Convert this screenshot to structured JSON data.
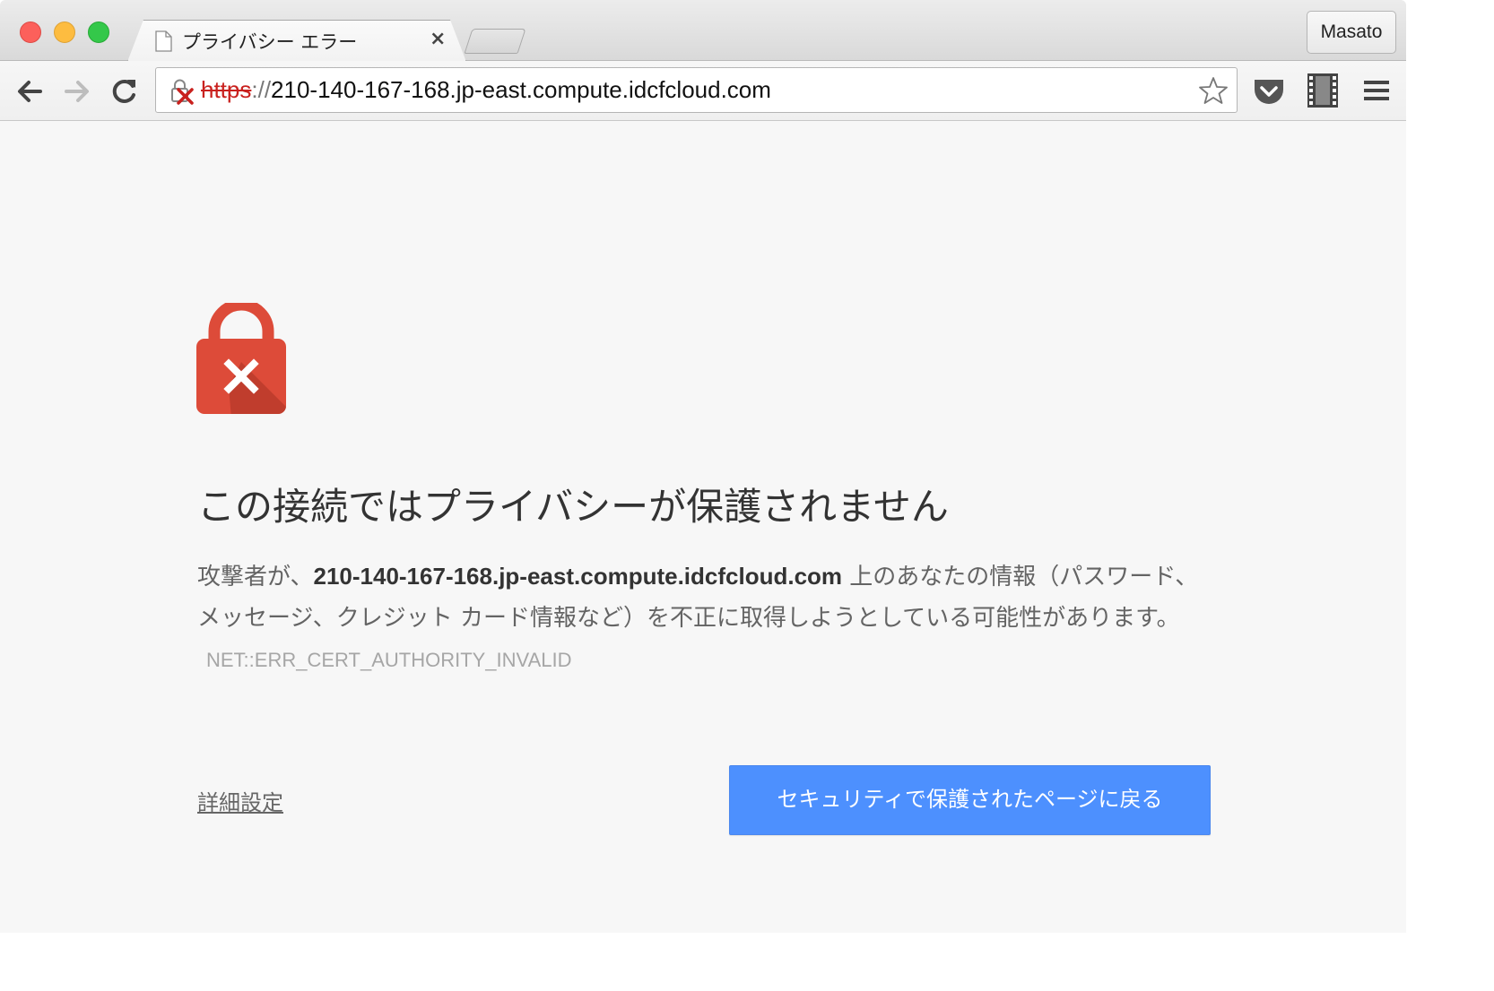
{
  "browser": {
    "tab": {
      "title": "プライバシー エラー",
      "close_glyph": "×"
    },
    "profile_name": "Masato",
    "address_bar": {
      "scheme": "https",
      "separator": "://",
      "host": "210-140-167-168.jp-east.compute.idcfcloud.com",
      "security_state": "not-secure"
    },
    "toolbar_icons": [
      "back-arrow-icon",
      "forward-arrow-icon",
      "reload-icon",
      "bookmark-star-icon",
      "pocket-icon",
      "film-icon",
      "hamburger-menu-icon"
    ]
  },
  "page": {
    "heading": "この接続ではプライバシーが保護されません",
    "description": {
      "prefix": "攻撃者が、",
      "host": "210-140-167-168.jp-east.compute.idcfcloud.com",
      "suffix": " 上のあなたの情報（パスワード、メッセージ、クレジット カード情報など）を不正に取得しようとしている可能性があります。",
      "error_code": "NET::ERR_CERT_AUTHORITY_INVALID"
    },
    "advanced_link": "詳細設定",
    "back_button": "セキュリティで保護されたページに戻る"
  },
  "colors": {
    "primary_button": "#4d90fe",
    "lock_red": "#dd4b39",
    "insecure_scheme": "#c9211e",
    "page_background": "#f7f7f7"
  }
}
